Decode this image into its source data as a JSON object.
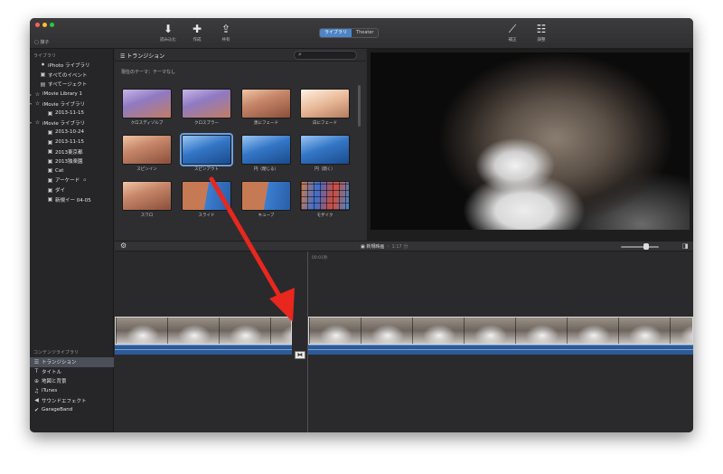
{
  "toolbar": {
    "left_label": "▢ 接子",
    "buttons": [
      {
        "icon": "⬇",
        "label": "読み込む"
      },
      {
        "icon": "✚",
        "label": "作成"
      },
      {
        "icon": "⇪",
        "label": "共有"
      }
    ],
    "segments": [
      "ライブラリ",
      "Theater"
    ],
    "right_buttons": [
      {
        "icon": "⟋",
        "label": "補正"
      },
      {
        "icon": "☷",
        "label": "調整"
      }
    ]
  },
  "sidebar": {
    "library_header": "ライブラリ",
    "items": [
      {
        "glyph": "⏺",
        "label": "iPhoto ライブラリ",
        "disclosure": ""
      },
      {
        "glyph": "▣",
        "label": "すべてのイベント",
        "disclosure": ""
      },
      {
        "glyph": "▤",
        "label": "すべてージェクト",
        "disclosure": ""
      },
      {
        "glyph": "☆",
        "label": "iMovie Library 1",
        "disclosure": "▸"
      },
      {
        "glyph": "☆",
        "label": "iMovie ライブラリ",
        "disclosure": "▾"
      },
      {
        "glyph": "▣",
        "label": "2013-11-15",
        "disclosure": ""
      },
      {
        "glyph": "☆",
        "label": "iMovie ライブラリ",
        "disclosure": "▾"
      },
      {
        "glyph": "▣",
        "label": "2013-10-24",
        "disclosure": ""
      },
      {
        "glyph": "▣",
        "label": "2013-11-15",
        "disclosure": ""
      },
      {
        "glyph": "▣",
        "label": "2013東京都",
        "disclosure": ""
      },
      {
        "glyph": "▣",
        "label": "2013独楽園",
        "disclosure": ""
      },
      {
        "glyph": "▣",
        "label": "Cat",
        "disclosure": ""
      },
      {
        "glyph": "▣",
        "label": "アーケード",
        "disclosure": "",
        "extra": "⌂"
      },
      {
        "glyph": "▣",
        "label": "ダイ",
        "disclosure": ""
      },
      {
        "glyph": "▣",
        "label": "新規イー 04-05",
        "disclosure": ""
      }
    ],
    "content_header": "コンテンツライブラリ",
    "content_items": [
      {
        "glyph": "☰",
        "label": "トランジション",
        "selected": true
      },
      {
        "glyph": "T",
        "label": "タイトル",
        "selected": false
      },
      {
        "glyph": "⊕",
        "label": "地図と背景",
        "selected": false
      },
      {
        "glyph": "♫",
        "label": "iTunes",
        "selected": false
      },
      {
        "glyph": "◀",
        "label": "サウンドエフェクト",
        "selected": false
      },
      {
        "glyph": "✔",
        "label": "GarageBand",
        "selected": false
      }
    ]
  },
  "browser": {
    "title": "☰ トランジション",
    "search_icon": "⌕",
    "theme_label": "現在のテーマ：テーマなし",
    "tiles": [
      {
        "caption": "クロスディゾルブ",
        "style": "purple"
      },
      {
        "caption": "クロスブラー",
        "style": "purple"
      },
      {
        "caption": "黒にフェード",
        "style": "warm"
      },
      {
        "caption": "白にフェード",
        "style": "pale"
      },
      {
        "caption": "スピンイン",
        "style": "warm"
      },
      {
        "caption": "スピンアウト",
        "style": "blue",
        "selected": true
      },
      {
        "caption": "円（閉じる）",
        "style": "blue"
      },
      {
        "caption": "円（開く）",
        "style": "blue"
      },
      {
        "caption": "スワロ",
        "style": "warm"
      },
      {
        "caption": "スライド",
        "style": "mix"
      },
      {
        "caption": "キューブ",
        "style": "mix"
      },
      {
        "caption": "モザイク",
        "style": "mosaic"
      }
    ]
  },
  "timeline": {
    "gear_icon": "⚙",
    "label_main": "▣ 新規映画",
    "label_dim": "・ 1:17 分",
    "timecode": "00:01秒",
    "right_icon": "◨",
    "transition_marker": "⧓"
  },
  "colors": {
    "accent": "#4d86c8",
    "arrow": "#e8271e",
    "window_bg": "#2b2b2d"
  }
}
